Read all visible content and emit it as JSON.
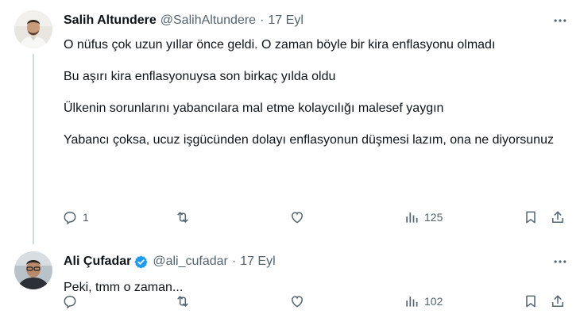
{
  "tweets": [
    {
      "author_name": "Salih Altundere",
      "handle": "@SalihAltundere",
      "separator": "·",
      "date": "17 Eyl",
      "paragraphs": [
        "O nüfus çok uzun yıllar önce geldi. O zaman böyle bir kira enflasyonu olmadı",
        "Bu aşırı kira enflasyonuysa son birkaç yılda oldu",
        "Ülkenin sorunlarını yabancılara mal etme kolaycılığı malesef yaygın",
        "Yabancı çoksa, ucuz işgücünden dolayı enflasyonun düşmesi lazım, ona ne diyorsunuz"
      ],
      "reply_count": "1",
      "retweet_count": "",
      "like_count": "",
      "view_count": "125"
    },
    {
      "author_name": "Ali Çufadar",
      "handle": "@ali_cufadar",
      "separator": "·",
      "date": "17 Eyl",
      "verified": true,
      "paragraphs": [
        "Peki, tmm o zaman..."
      ],
      "reply_count": "",
      "retweet_count": "",
      "like_count": "",
      "view_count": "102"
    }
  ],
  "colors": {
    "text_primary": "#0f1419",
    "text_secondary": "#536471",
    "verified_blue": "#1d9bf0",
    "thread_line": "#cfd9de"
  },
  "icons": [
    "reply-icon",
    "retweet-icon",
    "like-icon",
    "views-icon",
    "bookmark-icon",
    "share-icon",
    "more-icon",
    "verified-icon"
  ]
}
